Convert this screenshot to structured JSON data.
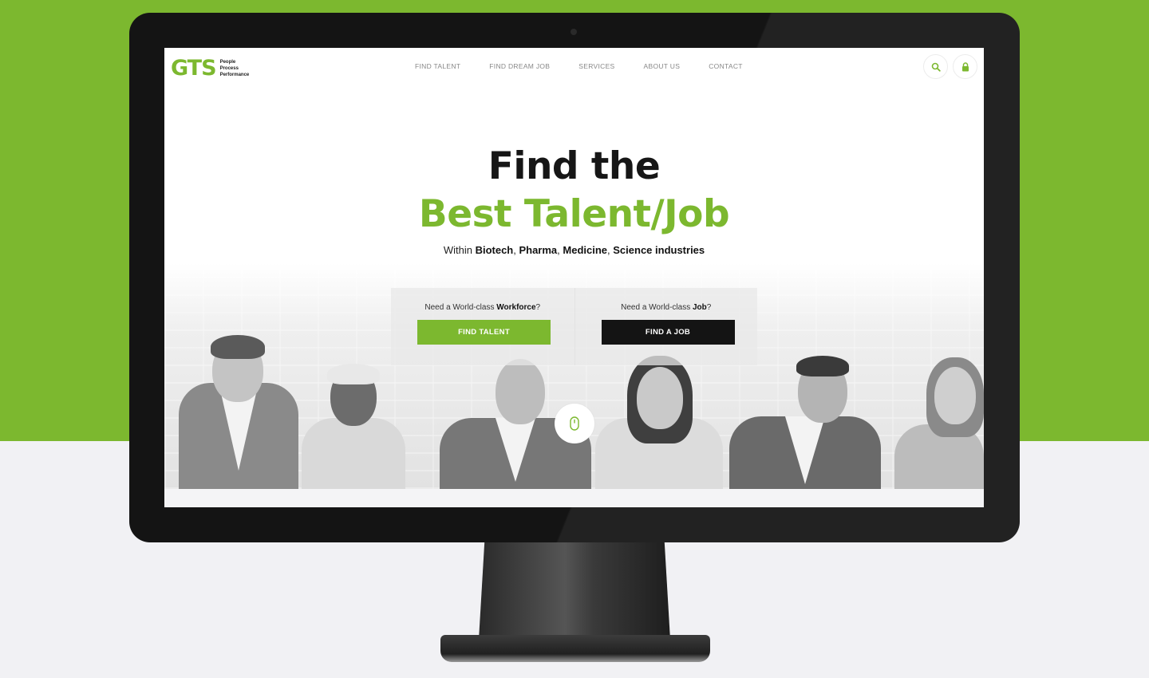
{
  "header": {
    "logo": {
      "mark": "GTS",
      "tags": [
        "People",
        "Process",
        "Performance"
      ]
    },
    "nav": [
      "FIND TALENT",
      "FIND DREAM JOB",
      "SERVICES",
      "ABOUT US",
      "CONTACT"
    ],
    "icons": {
      "search": "search-icon",
      "lock": "lock-icon"
    }
  },
  "hero": {
    "line1": "Find the",
    "line2": "Best Talent/Job",
    "subtitle": {
      "prefix": "Within ",
      "industries": [
        "Biotech",
        "Pharma",
        "Medicine",
        "Science industries"
      ],
      "sep": ", "
    }
  },
  "cta": {
    "talent": {
      "label_prefix": "Need a World-class ",
      "label_bold": "Workforce",
      "label_suffix": "?",
      "button": "FIND TALENT"
    },
    "job": {
      "label_prefix": "Need a World-class ",
      "label_bold": "Job",
      "label_suffix": "?",
      "button": "FIND A JOB"
    }
  },
  "scroll_indicator": {
    "icon": "mouse-icon"
  },
  "colors": {
    "accent": "#7cb82f",
    "dark": "#141414",
    "background_light": "#f1f1f4"
  }
}
